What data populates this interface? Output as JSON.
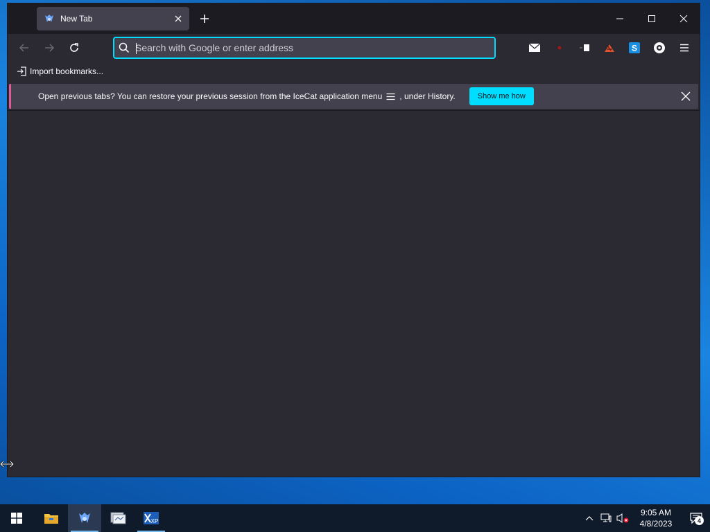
{
  "browser": {
    "app_name": "IceCat",
    "tab": {
      "title": "New Tab",
      "close_glyph": "✕"
    },
    "new_tab_glyph": "+",
    "window_controls": {
      "minimize": "—",
      "maximize": "☐",
      "close": "✕"
    },
    "urlbar": {
      "placeholder": "Search with Google or enter address",
      "value": ""
    },
    "bookmarks": {
      "import_label": "Import bookmarks..."
    },
    "notification": {
      "text_before": "Open previous tabs? You can restore your previous session from the IceCat application menu",
      "text_after": ", under History.",
      "button_label": "Show me how"
    },
    "toolbar_icons": [
      "mail-icon",
      "red-dot-extension-icon",
      "extension-icon",
      "bug-extension-icon",
      "s-extension-icon",
      "eye-extension-icon",
      "hamburger-menu-icon"
    ]
  },
  "taskbar": {
    "apps": [
      "start-icon",
      "file-explorer-icon",
      "icecat-icon",
      "app-icon",
      "xp-app-icon"
    ],
    "clock": {
      "time": "9:05 AM",
      "date": "4/8/2023"
    },
    "notifications_count": "4"
  },
  "colors": {
    "accent": "#00ddff",
    "toolbar_bg": "#2b2a33",
    "tabstrip_bg": "#1c1b22",
    "notice_border": "#e05a99"
  }
}
